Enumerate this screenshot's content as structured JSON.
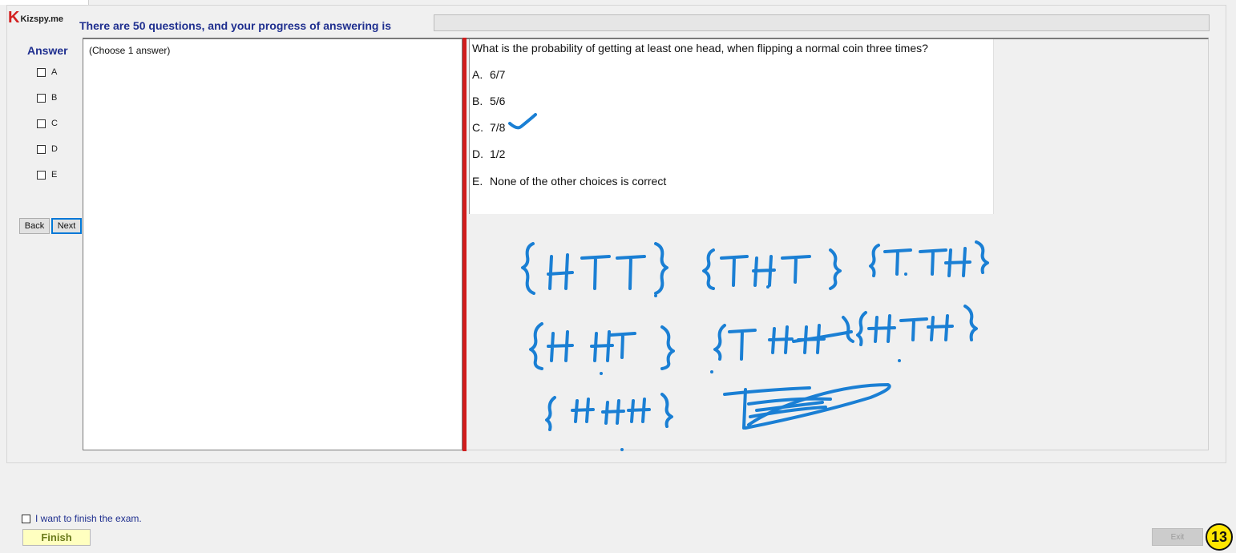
{
  "logo": {
    "mark": "K",
    "text": "Kizspy.me"
  },
  "header": {
    "progress_label": "There are 50 questions, and your progress of answering is",
    "progress_fraction": 0
  },
  "answer_sidebar": {
    "title": "Answer",
    "options": [
      "A",
      "B",
      "C",
      "D",
      "E"
    ],
    "checked": [
      false,
      false,
      false,
      false,
      false
    ]
  },
  "navigation": {
    "back_label": "Back",
    "next_label": "Next"
  },
  "answer_panel": {
    "hint": "(Choose 1 answer)"
  },
  "question": {
    "text": "What is the probability of getting at least one head, when flipping a normal coin three times?",
    "choices": [
      {
        "letter": "A.",
        "text": "6/7"
      },
      {
        "letter": "B.",
        "text": "5/6"
      },
      {
        "letter": "C.",
        "text": "7/8"
      },
      {
        "letter": "D.",
        "text": "1/2"
      },
      {
        "letter": "E.",
        "text": "None of the other choices is correct"
      }
    ]
  },
  "ink": {
    "color": "#1a7fd4",
    "notes": [
      "{HTT}",
      "{THT}",
      "{TTH}",
      "{HHT}",
      "{THH}",
      "{HTH}",
      "{HHH}",
      "{TTT}"
    ]
  },
  "footer": {
    "finish_checkbox_label": "I want to finish the exam.",
    "finish_label": "Finish",
    "exit_label": "Exit",
    "badge": "13"
  },
  "colors": {
    "accent_blue": "#1f2f8f",
    "splitter_red": "#d01d1d",
    "finish_bg": "#ffffc0",
    "badge_yellow": "#ffe600"
  }
}
